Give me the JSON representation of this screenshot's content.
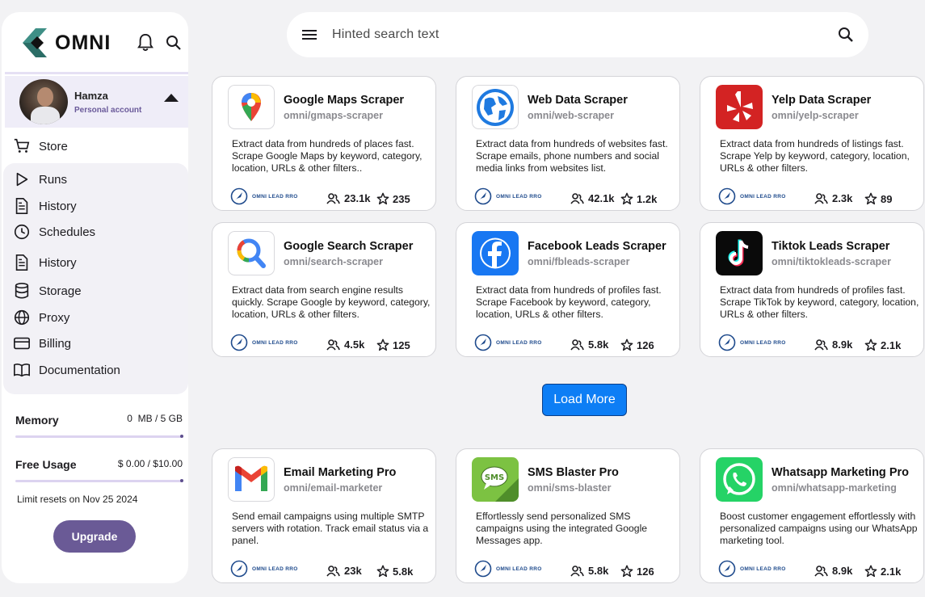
{
  "brand": {
    "name": "OMNI"
  },
  "account": {
    "name": "Hamza",
    "type": "Personal account"
  },
  "nav": {
    "store": "Store",
    "items": [
      "Runs",
      "History",
      "Schedules",
      "History",
      "Storage",
      "Proxy",
      "Billing",
      "Documentation"
    ]
  },
  "usage": {
    "memory_label": "Memory",
    "memory_value": "0  MB / 5 GB",
    "free_label": "Free Usage",
    "free_value": "$ 0.00 / $10.00",
    "limit_text": "Limit resets on Nov 25 2024",
    "upgrade": "Upgrade"
  },
  "search": {
    "placeholder": "Hinted search text"
  },
  "load_more": "Load More",
  "badge_text": "OMNI LEAD RRO",
  "cards": [
    {
      "title": "Google Maps Scraper",
      "slug": "omni/gmaps-scraper",
      "desc": "Extract data from hundreds of places fast. Scrape Google Maps by keyword, category, location, URLs & other filters..",
      "users": "23.1k",
      "stars": "235",
      "icon": "google-maps-icon"
    },
    {
      "title": "Web Data Scraper",
      "slug": "omni/web-scraper",
      "desc": "Extract data from hundreds of websites fast. Scrape emails, phone numbers and social media links from websites list.",
      "users": "42.1k",
      "stars": "1.2k",
      "icon": "globe-icon"
    },
    {
      "title": "Yelp Data Scraper",
      "slug": "omni/yelp-scraper",
      "desc": "Extract data from hundreds of listings fast. Scrape Yelp by keyword, category, location, URLs & other filters.",
      "users": "2.3k",
      "stars": "89",
      "icon": "yelp-icon"
    },
    {
      "title": "Google Search Scraper",
      "slug": "omni/search-scraper",
      "desc": "Extract data from search engine results quickly. Scrape Google by keyword, category, location, URLs & other filters.",
      "users": "4.5k",
      "stars": "125",
      "icon": "google-search-icon"
    },
    {
      "title": "Facebook Leads Scraper",
      "slug": "omni/fbleads-scraper",
      "desc": "Extract data from hundreds of profiles fast. Scrape Facebook by keyword, category, location, URLs & other filters.",
      "users": "5.8k",
      "stars": "126",
      "icon": "facebook-icon"
    },
    {
      "title": "Tiktok Leads Scraper",
      "slug": "omni/tiktokleads-scraper",
      "desc": "Extract data from hundreds of profiles fast. Scrape TikTok by keyword, category, location, URLs & other filters.",
      "users": "8.9k",
      "stars": "2.1k",
      "icon": "tiktok-icon"
    },
    {
      "title": "Email Marketing Pro",
      "slug": "omni/email-marketer",
      "desc": "Send email campaigns using multiple SMTP servers with rotation. Track email status via a panel.",
      "users": "23k",
      "stars": "5.8k",
      "icon": "gmail-icon"
    },
    {
      "title": "SMS Blaster Pro",
      "slug": "omni/sms-blaster",
      "desc": "Effortlessly send personalized SMS campaigns using the integrated Google Messages app.",
      "users": "5.8k",
      "stars": "126",
      "icon": "sms-icon"
    },
    {
      "title": "Whatsapp Marketing Pro",
      "slug": "omni/whatsapp-marketing",
      "desc": "Boost customer engagement effortlessly with personalized campaigns using our WhatsApp marketing tool.",
      "users": "8.9k",
      "stars": "2.1k",
      "icon": "whatsapp-icon"
    }
  ]
}
